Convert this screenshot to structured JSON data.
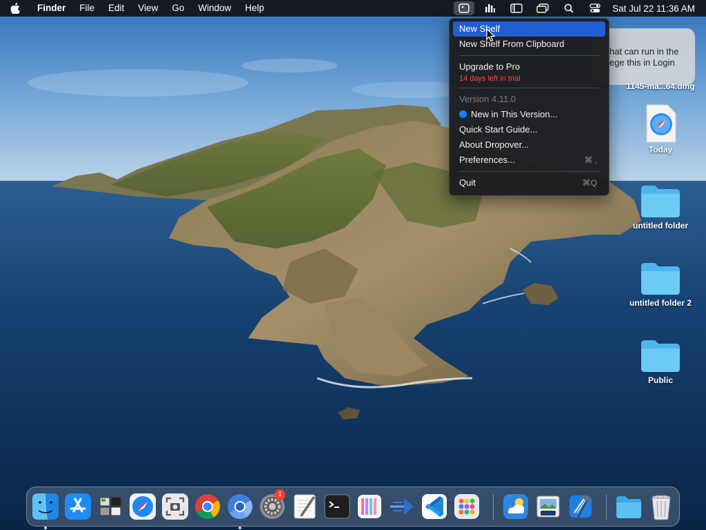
{
  "menubar": {
    "app_name": "Finder",
    "menus": [
      "File",
      "Edit",
      "View",
      "Go",
      "Window",
      "Help"
    ],
    "status_icons": [
      "dropover-icon",
      "istat-icon",
      "sidebar-icon",
      "windows-icon",
      "spotlight-icon",
      "control-center-icon"
    ],
    "clock": "Sat Jul 22  11:36 AM"
  },
  "notification": {
    "line1": "hat can run in the",
    "line2": "ege this in Login"
  },
  "dropdown": {
    "new_shelf": "New Shelf",
    "new_shelf_clipboard": "New Shelf From Clipboard",
    "upgrade": "Upgrade to Pro",
    "trial": "14 days left in trial",
    "version": "Version 4.11.0",
    "new_in_version": "New in This Version...",
    "quick_start": "Quick Start Guide...",
    "about": "About Dropover...",
    "preferences": "Preferences...",
    "preferences_shortcut": "⌘ ,",
    "quit": "Quit",
    "quit_shortcut": "⌘Q"
  },
  "desktop": {
    "dmg_label": "1145-ma...64.dmg",
    "today_label": "Today",
    "folder1_label": "untitled folder",
    "folder2_label": "untitled folder 2",
    "public_label": "Public"
  },
  "dock": {
    "apps": [
      "Finder",
      "App Store",
      "Desktop Manager",
      "Safari",
      "Screenshot",
      "Google Chrome",
      "Chromium",
      "System Preferences",
      "TextEdit",
      "Terminal",
      "Stripe Board",
      "Dropover Push",
      "Visual Studio Code",
      "Launchpad",
      "Weather",
      "Preview",
      "Xcode",
      "Downloads",
      "Trash"
    ],
    "system_prefs_badge": "1"
  },
  "colors": {
    "highlight": "#1f5fd1",
    "trial_red": "#ff453a",
    "folder_blue": "#5ac8fa"
  }
}
